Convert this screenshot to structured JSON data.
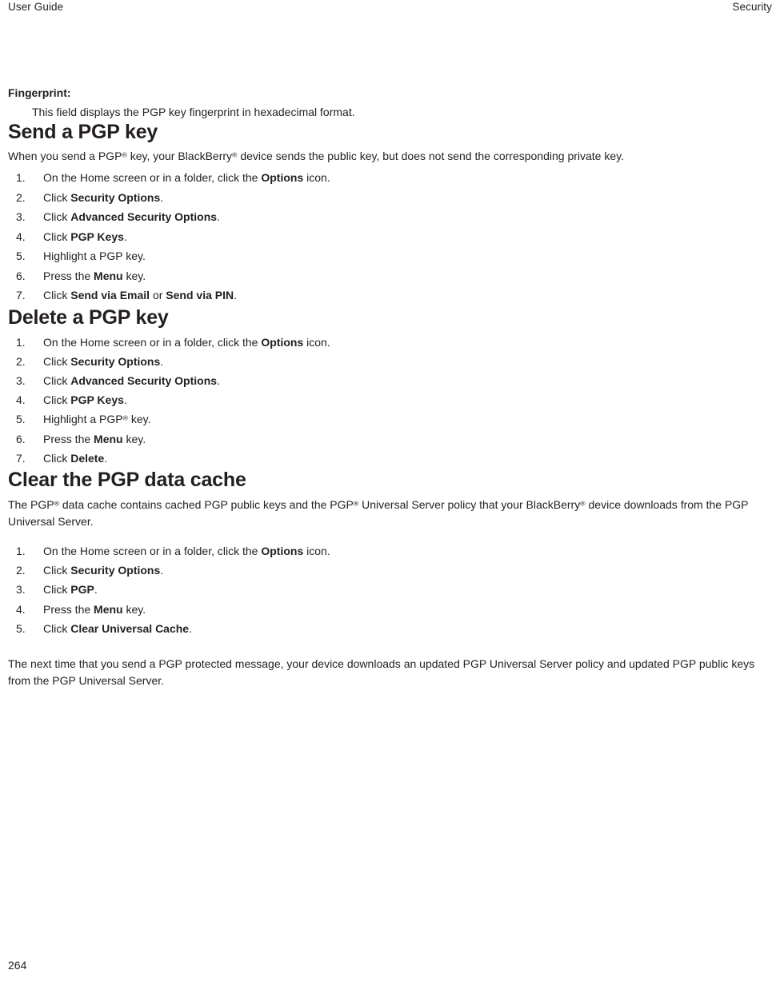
{
  "header": {
    "left": "User Guide",
    "right": "Security"
  },
  "definition": {
    "term": "Fingerprint:",
    "description": "This field displays the PGP key fingerprint in hexadecimal format."
  },
  "sections": [
    {
      "id": "send-a-pgp-key",
      "title": "Send a PGP key",
      "intro": "When you send a PGP® key, your BlackBerry® device sends the public key, but does not send the corresponding private key.",
      "steps": [
        "On the Home screen or in a folder, click the Options icon.",
        "Click Security Options.",
        "Click Advanced Security Options.",
        "Click PGP Keys.",
        "Highlight a PGP key.",
        "Press the Menu key.",
        "Click Send via Email or Send via PIN."
      ]
    },
    {
      "id": "delete-a-pgp-key",
      "title": "Delete a PGP key",
      "steps": [
        "On the Home screen or in a folder, click the Options icon.",
        "Click Security Options.",
        "Click Advanced Security Options.",
        "Click PGP Keys.",
        "Highlight a PGP® key.",
        "Press the Menu key.",
        "Click Delete."
      ]
    },
    {
      "id": "clear-the-pgp-data-cache",
      "title": "Clear the PGP data cache",
      "intro": "The PGP® data cache contains cached PGP public keys and the PGP® Universal Server policy that your BlackBerry® device downloads from the PGP Universal Server.",
      "steps": [
        "On the Home screen or in a folder, click the Options icon.",
        "Click Security Options.",
        "Click PGP.",
        "Press the Menu key.",
        "Click Clear Universal Cache."
      ],
      "outro": "The next time that you send a PGP protected message, your device downloads an updated PGP Universal Server policy and updated PGP public keys from the PGP Universal Server."
    }
  ],
  "footer": {
    "page_number": "264"
  },
  "colors": {
    "text": "#231f20",
    "background": "#ffffff"
  }
}
